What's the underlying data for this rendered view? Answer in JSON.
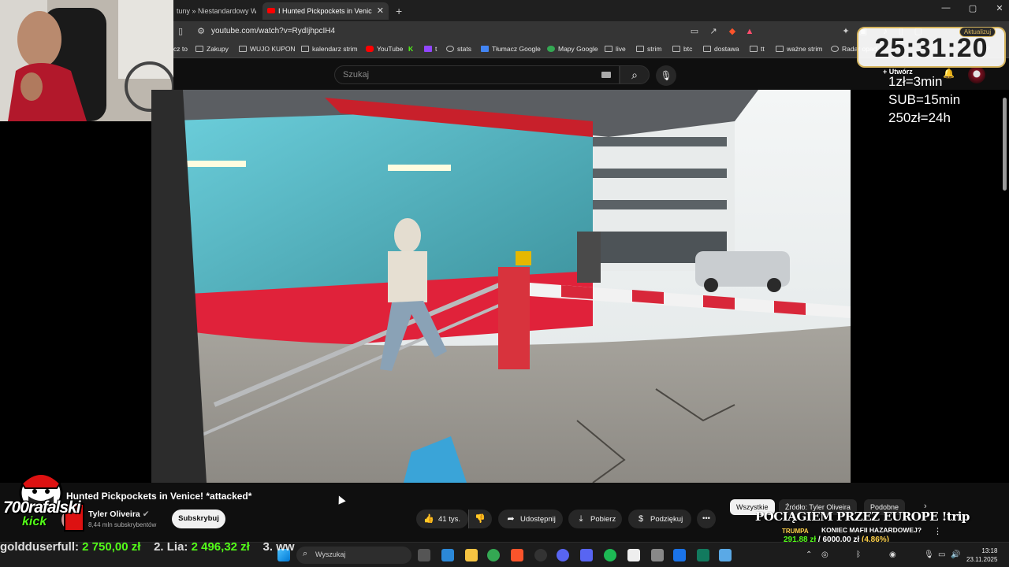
{
  "browser": {
    "tabs": [
      {
        "label": "tuny » Niestandardowy Wyb…",
        "active": false
      },
      {
        "label": "I Hunted Pickpockets in Venic",
        "active": true
      }
    ],
    "new_tab_label": "+",
    "url": "youtube.com/watch?v=RydIjhpcIH4",
    "window_controls": [
      "—",
      "▢",
      "✕"
    ],
    "bookmarks": [
      "cz to",
      "Zakupy",
      "WUJO KUPON",
      "kalendarz strim",
      "YouTube",
      "t",
      "stats",
      "Tłumacz Google",
      "Mapy Google",
      "live",
      "strim",
      "btc",
      "dostawa",
      "tt",
      "ważne strim",
      "Radar opad"
    ],
    "update_button": "Aktualizuj"
  },
  "youtube": {
    "search_placeholder": "Szukaj",
    "create_label": "Utwórz",
    "video_title": "Hunted Pickpockets in Venice! *attacked*",
    "channel_name": "Tyler Oliveira",
    "channel_subs": "8,44 mln subskrybentów",
    "subscribe_label": "Subskrybuj",
    "actions": {
      "likes": "41 tys.",
      "share": "Udostępnij",
      "download": "Pobierz",
      "thanks": "Podziękuj",
      "more": "•••"
    },
    "chips": [
      "Wszystkie",
      "Źródło: Tyler Oliveira",
      "Podobne"
    ]
  },
  "stream_overlay": {
    "timer": "25:31:20",
    "rates": [
      "1zł=3min",
      "SUB=15min",
      "250zł=24h"
    ],
    "kick_channel": "700rafalski",
    "kick_word": "kick",
    "ticker": [
      {
        "name": "goldduserfull:",
        "value": "2 750,00 zł"
      },
      {
        "name": "2. Lia:",
        "value": "2 496,32 zł"
      },
      {
        "name": "3. ww",
        "value": ""
      }
    ],
    "promo_title": "POCIĄGIEM PRZEZ EUROPE !trip",
    "promo_subtitle": "KONIEC MAFII HAZARDOWEJ?",
    "promo_badge": "TRUMPA",
    "promo_raised": "291,88 zł",
    "promo_goal": "6000,00 zł",
    "promo_percent": "(4.86%)"
  },
  "taskbar": {
    "search_placeholder": "Wyszukaj",
    "time": "13:18",
    "date": "23.11.2025"
  }
}
